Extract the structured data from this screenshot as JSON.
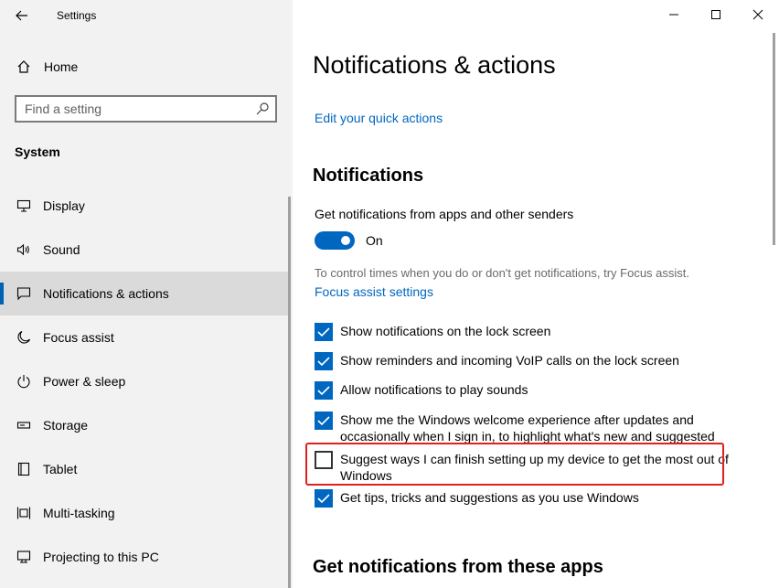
{
  "window": {
    "title": "Settings"
  },
  "sidebar": {
    "home_label": "Home",
    "search_placeholder": "Find a setting",
    "section": "System",
    "items": [
      {
        "label": "Display",
        "icon": "display-icon"
      },
      {
        "label": "Sound",
        "icon": "sound-icon"
      },
      {
        "label": "Notifications & actions",
        "icon": "notifications-icon",
        "selected": true
      },
      {
        "label": "Focus assist",
        "icon": "moon-icon"
      },
      {
        "label": "Power & sleep",
        "icon": "power-icon"
      },
      {
        "label": "Storage",
        "icon": "storage-icon"
      },
      {
        "label": "Tablet",
        "icon": "tablet-icon"
      },
      {
        "label": "Multi-tasking",
        "icon": "multitasking-icon"
      },
      {
        "label": "Projecting to this PC",
        "icon": "projecting-icon"
      }
    ]
  },
  "main": {
    "title": "Notifications & actions",
    "quick_actions_link": "Edit your quick actions",
    "notifications_heading": "Notifications",
    "get_notifications_label": "Get notifications from apps and other senders",
    "toggle_state": "On",
    "focus_text": "To control times when you do or don't get notifications, try Focus assist.",
    "focus_link": "Focus assist settings",
    "checkboxes": [
      {
        "label": "Show notifications on the lock screen",
        "checked": true
      },
      {
        "label": "Show reminders and incoming VoIP calls on the lock screen",
        "checked": true
      },
      {
        "label": "Allow notifications to play sounds",
        "checked": true
      },
      {
        "label": "Show me the Windows welcome experience after updates and occasionally when I sign in, to highlight what's new and suggested",
        "checked": true
      },
      {
        "label": "Suggest ways I can finish setting up my device to get the most out of Windows",
        "checked": false
      },
      {
        "label": "Get tips, tricks and suggestions as you use Windows",
        "checked": true
      }
    ],
    "apps_heading": "Get notifications from these apps"
  },
  "colors": {
    "accent": "#0067c0",
    "highlight": "#e0201d"
  }
}
